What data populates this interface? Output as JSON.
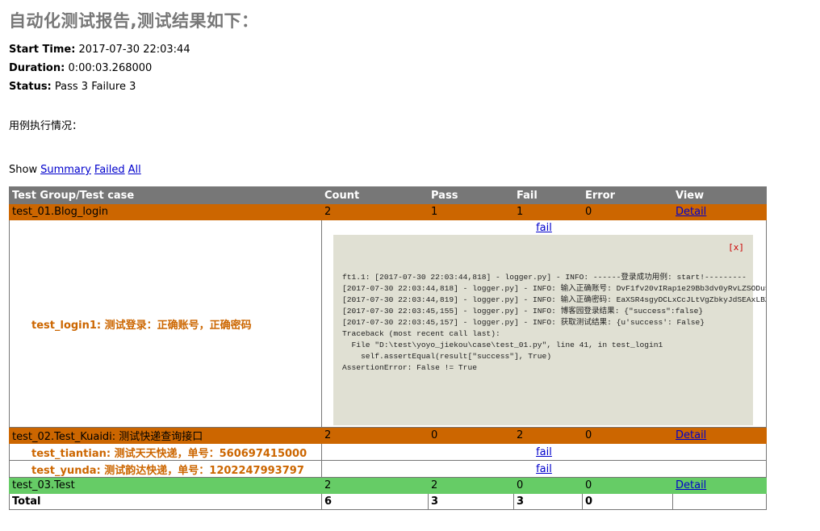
{
  "report": {
    "heading": "自动化测试报告,测试结果如下：",
    "attributes": [
      {
        "label": "Start Time:",
        "value": "2017-07-30 22:03:44"
      },
      {
        "label": "Duration:",
        "value": "0:00:03.268000"
      },
      {
        "label": "Status:",
        "value": "Pass 3 Failure 3"
      }
    ],
    "cases_label": "用例执行情况："
  },
  "show": {
    "label": "Show",
    "links": [
      "Summary",
      "Failed",
      "All"
    ]
  },
  "table": {
    "headers": [
      "Test Group/Test case",
      "Count",
      "Pass",
      "Fail",
      "Error",
      "View"
    ],
    "groups": [
      {
        "name": "test_01.Blog_login",
        "count": "2",
        "pass": "1",
        "fail": "1",
        "error": "0",
        "view": "Detail",
        "status": "fail"
      },
      {
        "name": "test_02.Test_Kuaidi: 测试快递查询接口",
        "count": "2",
        "pass": "0",
        "fail": "2",
        "error": "0",
        "view": "Detail",
        "status": "fail"
      },
      {
        "name": "test_03.Test",
        "count": "2",
        "pass": "2",
        "fail": "0",
        "error": "0",
        "view": "Detail",
        "status": "pass"
      }
    ],
    "cases": [
      {
        "name": "test_login1: 测试登录：正确账号，正确密码",
        "link": "fail"
      },
      {
        "name": "test_tiantian: 测试天天快递，单号：560697415000",
        "link": "fail"
      },
      {
        "name": "test_yunda: 测试韵达快递，单号：1202247993797",
        "link": "fail"
      }
    ],
    "total": {
      "label": "Total",
      "count": "6",
      "pass": "3",
      "fail": "3",
      "error": "0"
    }
  },
  "popup": {
    "close": "[x]",
    "log": "ft1.1: [2017-07-30 22:03:44,818] - logger.py] - INFO: ------登录成功用例: start!---------\n[2017-07-30 22:03:44,818] - logger.py] - INFO: 输入正确账号: DvF1fv20vIRap1e29Bb3dv0yRvLZSODu5qjXfo5XSBTPLJFg5z\n[2017-07-30 22:03:44,819] - logger.py] - INFO: 输入正确密码: EaXSR4sgyDCLxCcJLtVgZbkyJdSEAxLBZYQhQ/vjedSeik/zAJ\n[2017-07-30 22:03:45,155] - logger.py] - INFO: 博客园登录结果: {\"success\":false}\n[2017-07-30 22:03:45,157] - logger.py] - INFO: 获取测试结果: {u'success': False}\nTraceback (most recent call last):\n  File \"D:\\test\\yoyo_jiekou\\case\\test_01.py\", line 41, in test_login1\n    self.assertEqual(result[\"success\"], True)\nAssertionError: False != True"
  }
}
